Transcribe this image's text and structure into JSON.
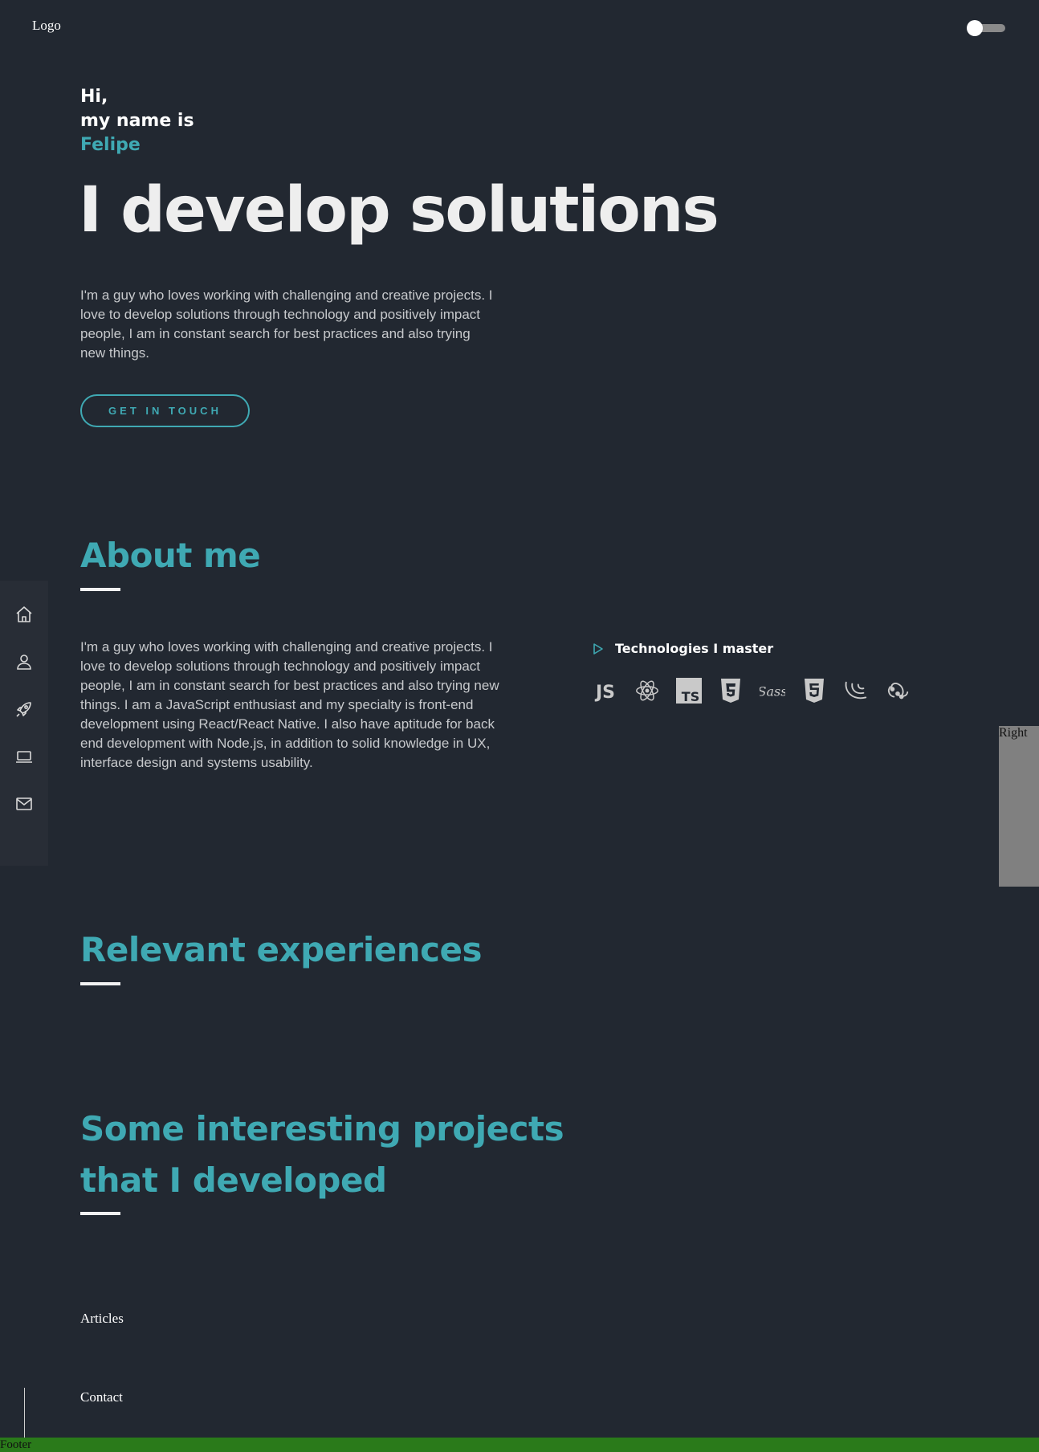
{
  "header": {
    "logo": "Logo"
  },
  "hero": {
    "greeting_line1": "Hi,",
    "greeting_line2": "my name is",
    "name": "Felipe",
    "headline": "I develop solutions",
    "intro": "I'm a guy who loves working with challenging and creative projects. I love to develop solutions through technology and positively impact people, I am in constant search for best practices and also trying new things.",
    "cta_label": "GET IN TOUCH"
  },
  "about": {
    "title": "About me",
    "text": "I'm a guy who loves working with challenging and creative projects. I love to develop solutions through technology and positively impact people, I am in constant search for best practices and also trying new things. I am a JavaScript enthusiast and my specialty is front-end development using React/React Native. I also have aptitude for back end development with Node.js, in addition to solid knowledge in UX, interface design and systems usability.",
    "tech_heading": "Technologies I master",
    "tech_icons": [
      "javascript-icon",
      "react-icon",
      "typescript-icon",
      "css3-icon",
      "sass-icon",
      "html5-icon",
      "jquery-icon",
      "redux-icon"
    ]
  },
  "sidenav": {
    "items": [
      "home-icon",
      "user-icon",
      "rocket-icon",
      "laptop-icon",
      "mail-icon"
    ]
  },
  "experiences": {
    "title": "Relevant experiences"
  },
  "projects": {
    "title_line1": "Some interesting projects",
    "title_line2": "that I developed"
  },
  "links": {
    "articles": "Articles",
    "contact": "Contact"
  },
  "right_panel": {
    "label": "Right"
  },
  "footer": {
    "label": "Footer"
  },
  "colors": {
    "background": "#222831",
    "accent": "#3fa9b3",
    "text": "#c7c9cc"
  }
}
